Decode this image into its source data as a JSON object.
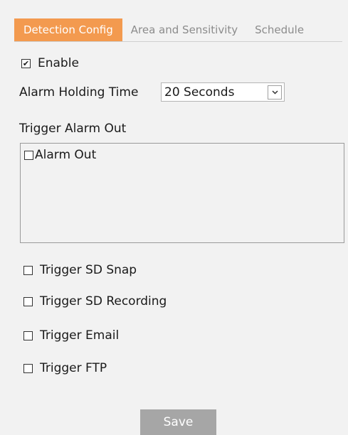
{
  "tabs": [
    {
      "label": "Detection Config",
      "active": true
    },
    {
      "label": "Area and Sensitivity",
      "active": false
    },
    {
      "label": "Schedule",
      "active": false
    }
  ],
  "enable": {
    "label": "Enable",
    "checked": true
  },
  "alarm_holding_time": {
    "label": "Alarm Holding Time",
    "value": "20 Seconds"
  },
  "trigger_alarm_out": {
    "label": "Trigger Alarm Out",
    "items": [
      {
        "label": "Alarm Out",
        "checked": false
      }
    ]
  },
  "triggers": [
    {
      "label": "Trigger SD Snap",
      "checked": false
    },
    {
      "label": "Trigger SD Recording",
      "checked": false
    },
    {
      "label": "Trigger Email",
      "checked": false
    },
    {
      "label": "Trigger FTP",
      "checked": false
    }
  ],
  "save_label": "Save",
  "colors": {
    "accent": "#f39a4f",
    "button": "#a6a6a6",
    "background": "#f2f2f2"
  }
}
